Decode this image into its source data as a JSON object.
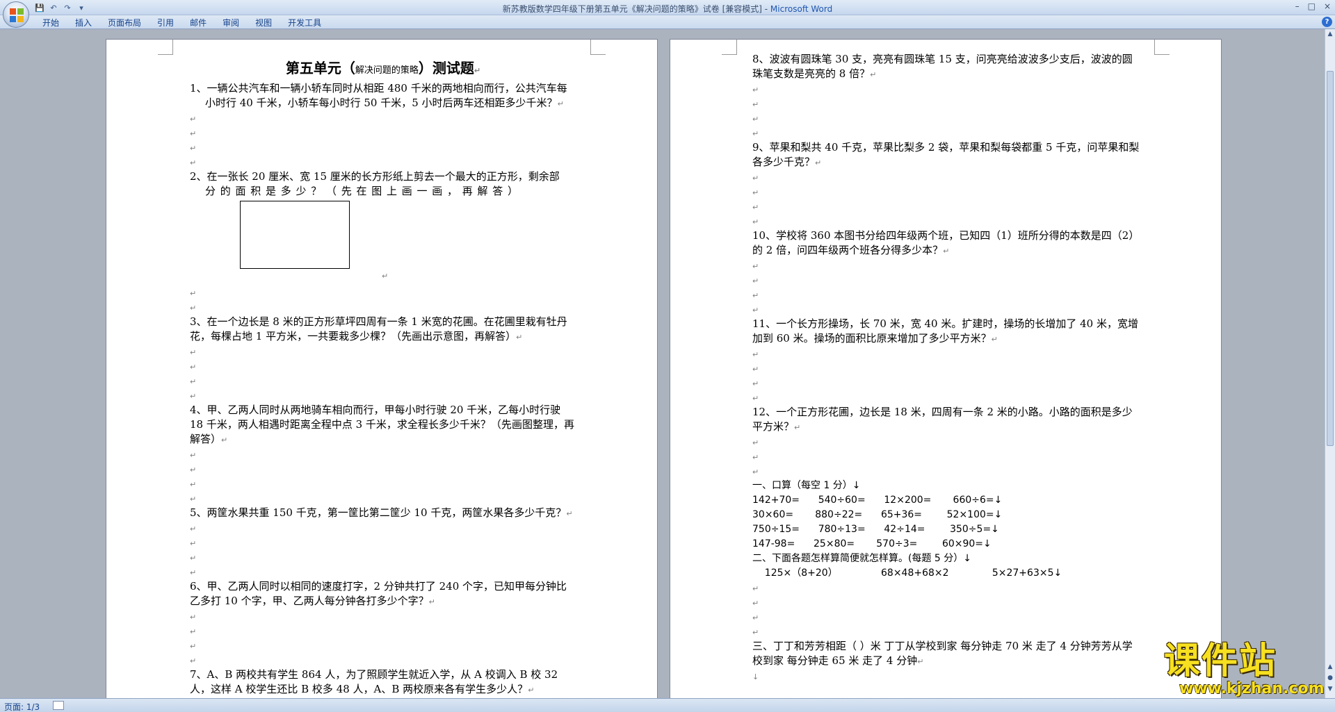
{
  "window": {
    "title": "新苏教版数学四年级下册第五单元《解决问题的策略》试卷 [兼容模式] - ",
    "app": "Microsoft Word",
    "controls": [
      "–",
      "□",
      "×"
    ]
  },
  "quick_access": [
    "💾",
    "↶",
    "↷",
    "▾"
  ],
  "ribbon": {
    "tabs": [
      "开始",
      "插入",
      "页面布局",
      "引用",
      "邮件",
      "审阅",
      "视图",
      "开发工具"
    ],
    "help": "?"
  },
  "para_mark": "↵",
  "page1": {
    "title_main": "第五单元（",
    "title_small": "解决问题的策略",
    "title_end": "）测试题",
    "questions": {
      "q1": "1、一辆公共汽车和一辆小轿车同时从相距 480 千米的两地相向而行，公共汽车每小时行 40 千米，小轿车每小时行 50 千米，5 小时后两车还相距多少千米？",
      "q2a": "2、在一张长 20 厘米、宽 15 厘米的长方形纸上剪去一个最大的正方形，剩余部",
      "q2b": "分的面积是多少？（先在图上画一画，再解答）",
      "q3": "3、在一个边长是 8 米的正方形草坪四周有一条 1 米宽的花圃。在花圃里栽有牡丹花，每棵占地 1 平方米，一共要栽多少棵？（先画出示意图，再解答）",
      "q4": "4、甲、乙两人同时从两地骑车相向而行，甲每小时行驶 20 千米，乙每小时行驶 18 千米，两人相遇时距离全程中点 3 千米，求全程长多少千米？（先画图整理，再解答）",
      "q5": "5、两筐水果共重 150 千克，第一筐比第二筐少 10 千克，两筐水果各多少千克？",
      "q6": "6、甲、乙两人同时以相同的速度打字，2 分钟共打了 240 个字，已知甲每分钟比乙多打 10 个字，甲、乙两人每分钟各打多少个字？",
      "q7": "7、A、B 两校共有学生 864 人，为了照顾学生就近入学，从 A 校调入 B 校 32 人，这样 A 校学生还比 B 校多 48 人，A、B 两校原来各有学生多少人？"
    }
  },
  "page2": {
    "questions": {
      "q8": "8、波波有圆珠笔 30 支，亮亮有圆珠笔 15 支，问亮亮给波波多少支后，波波的圆珠笔支数是亮亮的 8 倍？",
      "q9": "9、苹果和梨共 40 千克，苹果比梨多 2 袋，苹果和梨每袋都重 5 千克，问苹果和梨各多少千克？",
      "q10": "10、学校将 360 本图书分给四年级两个班，已知四（1）班所分得的本数是四（2）的 2 倍，问四年级两个班各分得多少本？",
      "q11": "11、一个长方形操场，长 70 米，宽 40 米。扩建时，操场的长增加了 40 米，宽增加到 60 米。操场的面积比原来增加了多少平方米？",
      "q12": "12、一个正方形花圃，边长是 18 米，四周有一条 2 米的小路。小路的面积是多少平方米？"
    },
    "section1": "一、口算（每空 1 分）↓",
    "arith_rows": [
      "142+70=      540÷60=      12×200=       660÷6=↓",
      "30×60=       880÷22=      65+36=        52×100=↓",
      "750÷15=      780÷13=      42÷14=        350÷5=↓",
      "147-98=      25×80=       570÷3=        60×90=↓"
    ],
    "section2": "二、下面各题怎样算简便就怎样算。(每题 5 分）↓",
    "calc_row": "    125×（8+20）              68×48+68×2              5×27+63×5↓",
    "section3": "三、丁丁和芳芳相距（     ）米    丁丁从学校到家 每分钟走 70 米 走了 4 分钟芳芳从学校到家 每分钟走 65 米 走了 4 分钟",
    "last_mark": "↓"
  },
  "status": {
    "page": "页面: 1/3"
  },
  "watermark": {
    "text": "课件站",
    "url": "www.kjzhan.com"
  }
}
